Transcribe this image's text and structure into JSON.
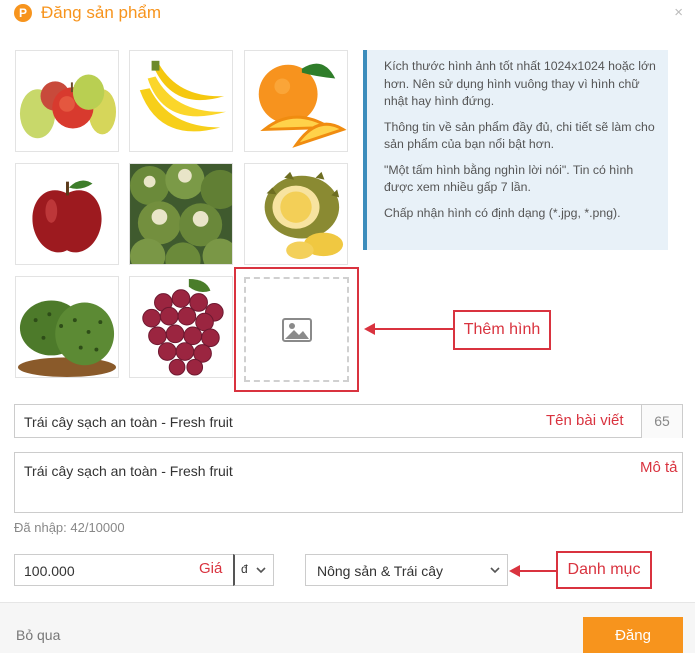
{
  "dialog": {
    "logo_letter": "P",
    "title": "Đăng sản phẩm",
    "close_symbol": "×"
  },
  "images": [
    {
      "name": "pears-apples"
    },
    {
      "name": "bananas"
    },
    {
      "name": "oranges"
    },
    {
      "name": "red-apple"
    },
    {
      "name": "green-coconuts"
    },
    {
      "name": "durian"
    },
    {
      "name": "soursop"
    },
    {
      "name": "grapes"
    }
  ],
  "info": {
    "p1": "Kích thước hình ảnh tốt nhất 1024x1024 hoặc lớn hơn. Nên sử dụng hình vuông thay vì hình chữ nhật hay hình đứng.",
    "p2": "Thông tin về sản phẩm đầy đủ, chi tiết sẽ làm cho sản phẩm của bạn nổi bật hơn.",
    "p3": "\"Một tấm hình bằng nghìn lời nói\". Tin có hình được xem nhiều gấp 7 lần.",
    "p4": "Chấp nhận hình có định dạng (*.jpg, *.png)."
  },
  "annotations": {
    "add_image": "Thêm hình",
    "post_title": "Tên bài viết",
    "description": "Mô tả",
    "price": "Giá",
    "category": "Danh mục"
  },
  "form": {
    "title_value": "Trái cây sạch an toàn - Fresh fruit",
    "title_counter": "65",
    "description_value": "Trái cây sạch an toàn - Fresh fruit",
    "entered_text": "Đã nhập: 42/10000",
    "price_value": "100.000",
    "currency_symbol": "đ",
    "category_value": "Nông sản & Trái cây"
  },
  "footer": {
    "skip_label": "Bỏ qua",
    "post_label": "Đăng"
  },
  "colors": {
    "brand_orange": "#f7941d",
    "annotation_red": "#d9333f",
    "info_border_blue": "#3c8dbc"
  }
}
